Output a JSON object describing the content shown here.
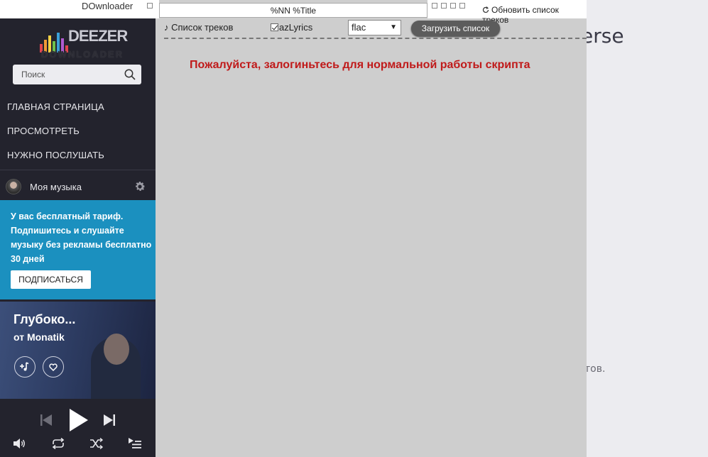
{
  "app": {
    "title": "DOwnloader"
  },
  "background_page": {
    "title_fragment": "erse",
    "text_fragment": "тов."
  },
  "sidebar": {
    "logo": {
      "brand": "DEEZER",
      "subtitle": "DOWNLOADER"
    },
    "search": {
      "placeholder": "Поиск"
    },
    "nav": [
      {
        "label": "ГЛАВНАЯ СТРАНИЦА"
      },
      {
        "label": "ПРОСМОТРЕТЬ"
      },
      {
        "label": "НУЖНО ПОСЛУШАТЬ"
      }
    ],
    "my_music": {
      "label": "Моя музыка",
      "icon": "gear-icon"
    },
    "promo": {
      "text": "У вас бесплатный тариф. Подпишитесь и слушайте музыку без рекламы бесплатно 30 дней",
      "button_label": "ПОДПИСАТЬСЯ"
    },
    "now_playing": {
      "title": "Глубоко...",
      "artist": "от Monatik"
    }
  },
  "toolbar": {
    "pattern_value": "%NN %Title",
    "refresh_label": "Обновить список треков",
    "track_list_label": "♪ Список треков",
    "azlyrics_label": "azLyrics",
    "azlyrics_checked": true,
    "format_value": "flac",
    "load_button_label": "Загрузить список"
  },
  "message": {
    "text": "Пожалуйста, залогиньтесь для нормальной работы скрипта",
    "color": "#c01a1a"
  },
  "colors": {
    "sidebar": "#23232d",
    "promo": "#1b90bf",
    "overlay": "#cecece"
  }
}
